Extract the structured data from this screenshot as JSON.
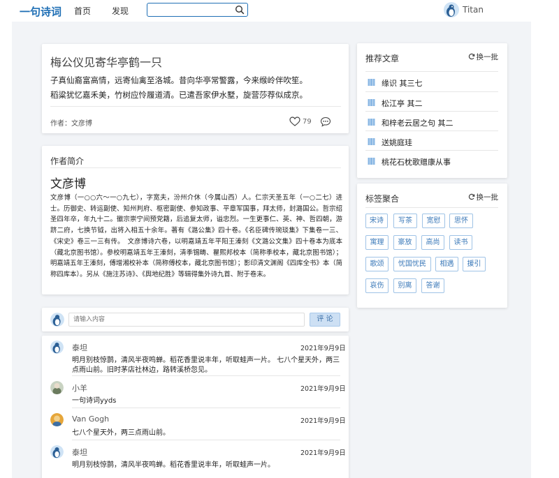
{
  "header": {
    "logo": "一句诗词",
    "nav": [
      "首页",
      "发现"
    ],
    "search": {
      "value": "",
      "placeholder": ""
    },
    "user_name": "Titan"
  },
  "poem": {
    "title": "梅公仪见寄华亭鹤一只",
    "lines": [
      "子真仙裔富高情，远寄仙禽至洛城。昔向华亭常警露，今来缑岭伴吹笙。",
      "稻粱犹忆嘉禾美，竹树应怜履道清。已遣吾家伊水墅，旋营莎荐似成京。"
    ],
    "author": "作者：文彦博",
    "likes": "79"
  },
  "author_intro": {
    "heading": "作者简介",
    "name": "文彦博",
    "bio": "文彦博（一○○六～一○九七），字宽夫，汾州介休（今属山西）人。仁宗天圣五年（一○二七）进士。历御史、转运副使、知州判府、枢密副使、参知政事、平章军国事，拜太师，封潞国公。哲宗绍圣四年卒，年九十二。徽宗崇宁间预党籍，后追复太师，谥忠烈。一生更事仁、英、神、哲四朝，游跻二府，七换节钺，出将入相五十余年。著有《潞公集》四十卷。《名臣碑传琬琰集》下集卷一三、《宋史》卷三一三有传。　文彦博诗六卷，以明嘉靖五年平阳王溱刻《文潞公文集》四十卷本为底本（藏北京图书馆）。参校明嘉靖五年王溱刻，清季锡畴、瞿熙邦校本（简称季校本，藏北京图书馆）；明嘉靖五年王溱刻，傅增湘校补本（简称傅校本，藏北京图书馆）；影印清文渊阁《四库全书》本（简称四库本）。另从《施注苏诗》、《舆地纪胜》等辑得集外诗九首、附于卷末。"
  },
  "comment_input": {
    "placeholder": "请输入内容",
    "submit_label": "评 论"
  },
  "comments": [
    {
      "user": "泰坦",
      "date": "2021年9月9日",
      "text": "明月别枝惊鹊，清风半夜鸣蝉。稻花香里说丰年，听取蛙声一片。 七八个星天外，两三点雨山前。旧时茅店社林边，路转溪桥忽见。"
    },
    {
      "user": "小羊",
      "date": "2021年9月9日",
      "text": "一句诗词yyds"
    },
    {
      "user": "Van Gogh",
      "date": "2021年9月9日",
      "text": "七八个星天外，两三点雨山前。"
    },
    {
      "user": "泰坦",
      "date": "2021年9月9日",
      "text": "明月别枝惊鹊，清风半夜鸣蝉。稻花香里说丰年，听取蛙声一片。"
    }
  ],
  "recommend": {
    "heading": "推荐文章",
    "refresh_label": "换一批",
    "items": [
      "缘识 其三七",
      "松江亭 其二",
      "和梓老云居之句 其二",
      "送姚庭珪",
      "桃花石枕歌赠康从事"
    ]
  },
  "tags": {
    "heading": "标签聚合",
    "refresh_label": "换一批",
    "items": [
      "宋诗",
      "写茶",
      "宽慰",
      "思怀",
      "寓理",
      "豪放",
      "高尚",
      "读书",
      "歌颂",
      "忧国忧民",
      "相遇",
      "援引",
      "哀伤",
      "别离",
      "答谢"
    ]
  },
  "colors": {
    "brand": "#1f6fb5",
    "background": "#f2f4f7",
    "tag_border": "#9fc3e6"
  }
}
